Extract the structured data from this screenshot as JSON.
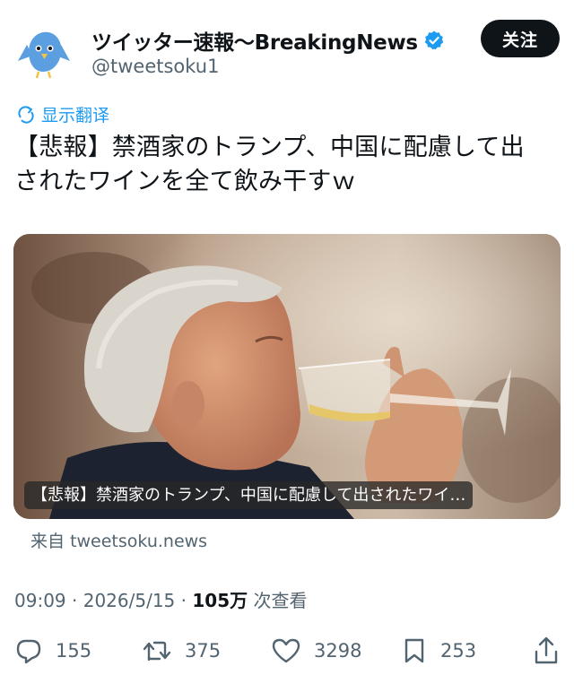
{
  "account": {
    "display_name": "ツイッター速報〜BreakingNews",
    "handle": "@tweetsoku1",
    "follow_label": "关注",
    "verified": true,
    "avatar_icon": "bird-avatar-icon",
    "brand_color": "#1d9bf0"
  },
  "translate": {
    "label": "显示翻译",
    "icon": "translate-icon"
  },
  "tweet": {
    "line1": "【悲報】禁酒家のトランプ、中国に配慮して出",
    "line2": "されたワインを全て飲み干すｗ"
  },
  "media": {
    "caption": "【悲報】禁酒家のトランプ、中国に配慮して出されたワイ…"
  },
  "source": {
    "prefix": "来自",
    "domain": "tweetsoku.news"
  },
  "meta": {
    "time": "09:09",
    "date": "2026/5/15",
    "views_count": "105万",
    "views_label": "次查看"
  },
  "actions": {
    "replies": "155",
    "retweets": "375",
    "likes": "3298",
    "bookmarks": "253"
  }
}
